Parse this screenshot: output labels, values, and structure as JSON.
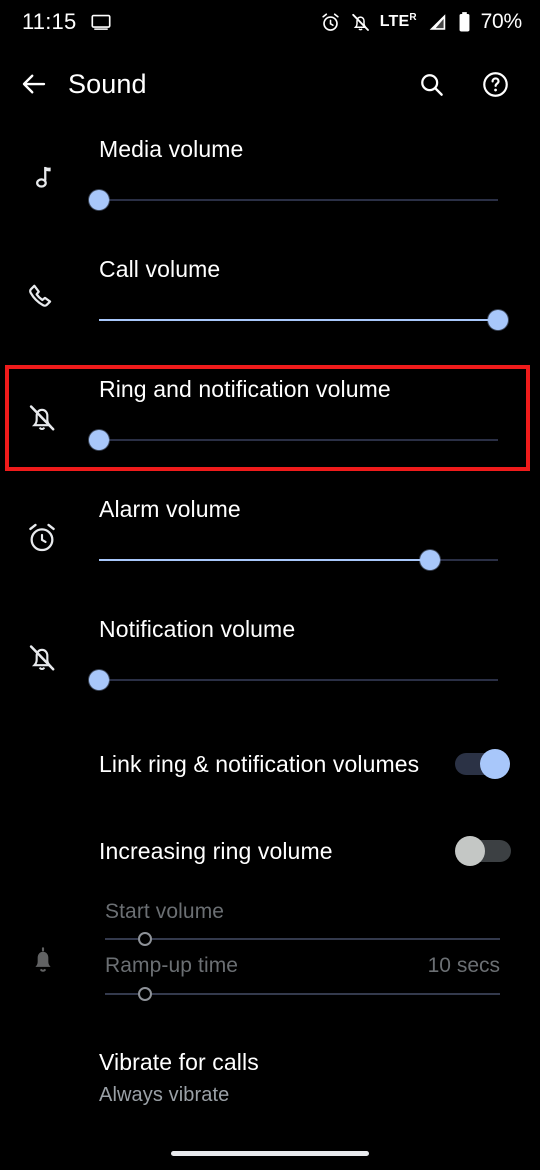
{
  "statusbar": {
    "time": "11:15",
    "battery_percent": "70%",
    "network_label": "LTE",
    "roaming_indicator": "R",
    "icons": [
      "cast-screen-icon",
      "alarm-icon",
      "notifications-off-icon",
      "lte-icon",
      "signal-icon",
      "battery-icon"
    ]
  },
  "appbar": {
    "title": "Sound",
    "back_icon": "back-arrow-icon",
    "search_icon": "search-icon",
    "help_icon": "help-circle-icon"
  },
  "highlight": {
    "color": "#ef1b1b",
    "target": "Ring and notification volume"
  },
  "volumes": [
    {
      "label": "Media volume",
      "icon": "music-note-icon",
      "value": 0,
      "thumb_pct": 0
    },
    {
      "label": "Call volume",
      "icon": "phone-icon",
      "value": 100,
      "thumb_pct": 100
    },
    {
      "label": "Ring and notification volume",
      "icon": "bell-off-icon",
      "value": 0,
      "thumb_pct": 0
    },
    {
      "label": "Alarm volume",
      "icon": "alarm-clock-icon",
      "value": 83,
      "thumb_pct": 83
    },
    {
      "label": "Notification volume",
      "icon": "bell-off-icon",
      "value": 0,
      "thumb_pct": 0
    }
  ],
  "switches": [
    {
      "label": "Link ring & notification volumes",
      "state": "on",
      "accent": "#a8c7fa"
    },
    {
      "label": "Increasing ring volume",
      "state": "off",
      "accent": "#c4c7c5"
    }
  ],
  "increasing_ring": {
    "icon": "bell-ring-icon",
    "disabled": true,
    "start_volume": {
      "label": "Start volume",
      "thumb_pct": 10
    },
    "ramp_up": {
      "label": "Ramp-up time",
      "value": "10 secs",
      "thumb_pct": 10
    }
  },
  "vibrate": {
    "title": "Vibrate for calls",
    "subtitle": "Always vibrate"
  },
  "navbar": {
    "gesture_pill": "home-gesture-pill"
  }
}
